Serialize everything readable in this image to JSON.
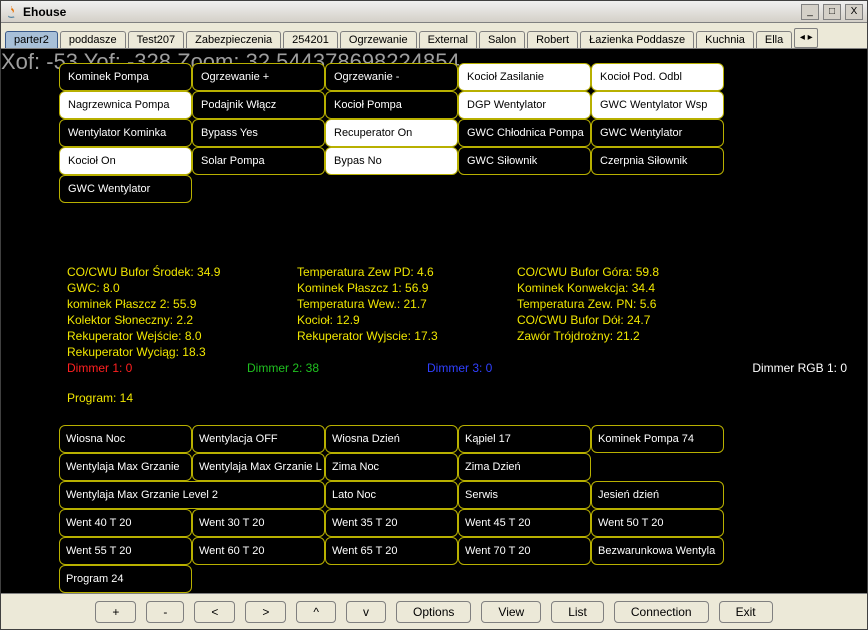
{
  "window": {
    "title": "Ehouse"
  },
  "winbtns": {
    "min": "_",
    "max": "□",
    "close": "X"
  },
  "tabs": {
    "items": [
      "parter2",
      "poddasze",
      "Test207",
      "Zabezpieczenia",
      "254201",
      "Ogrzewanie",
      "External",
      "Salon",
      "Robert",
      "Łazienka Poddasze",
      "Kuchnia",
      "Ella"
    ],
    "active_index": 0,
    "scroll_indicator": "◂ ▸"
  },
  "coords": "Xof: -53 Yof: -328 Zoom: 32.544378698224854",
  "controls": [
    {
      "label": "Kominek Pompa",
      "on": false
    },
    {
      "label": "Ogrzewanie +",
      "on": false
    },
    {
      "label": "Ogrzewanie -",
      "on": false
    },
    {
      "label": "Kocioł Zasilanie",
      "on": true
    },
    {
      "label": "Kocioł Pod. Odbl",
      "on": true
    },
    {
      "label": "Nagrzewnica Pompa",
      "on": true
    },
    {
      "label": "Podajnik Włącz",
      "on": false
    },
    {
      "label": "Kocioł Pompa",
      "on": false
    },
    {
      "label": "DGP Wentylator",
      "on": true
    },
    {
      "label": "GWC Wentylator Wsp",
      "on": true
    },
    {
      "label": "Wentylator Kominka",
      "on": false
    },
    {
      "label": "Bypass Yes",
      "on": false
    },
    {
      "label": "Recuperator On",
      "on": true
    },
    {
      "label": "GWC Chłodnica Pompa",
      "on": false
    },
    {
      "label": "GWC Wentylator",
      "on": false
    },
    {
      "label": "Kocioł On",
      "on": true
    },
    {
      "label": "Solar Pompa",
      "on": false
    },
    {
      "label": "Bypas No",
      "on": true
    },
    {
      "label": "GWC Siłownik",
      "on": false
    },
    {
      "label": "Czerpnia Siłownik",
      "on": false
    }
  ],
  "controls_row5": [
    {
      "label": "GWC Wentylator",
      "on": false
    }
  ],
  "stats": {
    "col1": [
      "CO/CWU Bufor Środek: 34.9",
      "GWC: 8.0",
      "kominek Płaszcz 2: 55.9",
      "Kolektor Słoneczny: 2.2",
      "Rekuperator Wejście: 8.0",
      "Rekuperator Wyciąg: 18.3"
    ],
    "col2": [
      "Temperatura Zew PD: 4.6",
      "Kominek Płaszcz 1: 56.9",
      "Temperatura Wew.: 21.7",
      "Kocioł: 12.9",
      "Rekuperator Wyjscie: 17.3"
    ],
    "col3": [
      "CO/CWU Bufor Góra: 59.8",
      "Kominek Konwekcja: 34.4",
      "Temperatura Zew. PN: 5.6",
      "CO/CWU Bufor Dół: 24.7",
      "Zawór Trójdrożny: 21.2"
    ],
    "dimmers": {
      "d1": "Dimmer 1: 0",
      "d2": "Dimmer 2: 38",
      "d3": "Dimmer 3: 0",
      "rgb": "Dimmer RGB 1: 0"
    },
    "program": "Program: 14"
  },
  "programs": [
    {
      "label": "Wiosna Noc",
      "wide": false
    },
    {
      "label": "Wentylacja OFF",
      "wide": false
    },
    {
      "label": "Wiosna Dzień",
      "wide": false
    },
    {
      "label": "Kąpiel 17",
      "wide": false
    },
    {
      "label": "Kominek Pompa 74",
      "wide": false
    },
    {
      "label": "Wentylaja Max Grzanie",
      "wide": false
    },
    {
      "label": "Wentylaja Max Grzanie L",
      "wide": false
    },
    {
      "label": "Zima Noc",
      "wide": false
    },
    {
      "label": "Zima Dzień",
      "wide": false
    },
    {
      "label": "Wentylaja Max Grzanie Level 2",
      "wide": true
    },
    {
      "label": "Lato Noc",
      "wide": false
    },
    {
      "label": "Serwis",
      "wide": false
    },
    {
      "label": "Jesień dzień",
      "wide": false
    },
    {
      "label": "Went 40 T 20",
      "wide": false
    },
    {
      "label": "Went 30 T 20",
      "wide": false
    },
    {
      "label": "Went 35 T 20",
      "wide": false
    },
    {
      "label": "Went 45 T 20",
      "wide": false
    },
    {
      "label": "Went 50 T 20",
      "wide": false
    },
    {
      "label": "Went 55 T 20",
      "wide": false
    },
    {
      "label": "Went 60 T 20",
      "wide": false
    },
    {
      "label": "Went 65 T 20",
      "wide": false
    },
    {
      "label": "Went 70 T 20",
      "wide": false
    },
    {
      "label": "Bezwarunkowa Wentyla",
      "wide": false
    },
    {
      "label": "Program 24",
      "wide": false
    }
  ],
  "footer": {
    "plus": "+",
    "minus": "-",
    "left": "<",
    "right": ">",
    "up": "^",
    "down": "v",
    "options": "Options",
    "view": "View",
    "list": "List",
    "connection": "Connection",
    "exit": "Exit"
  }
}
